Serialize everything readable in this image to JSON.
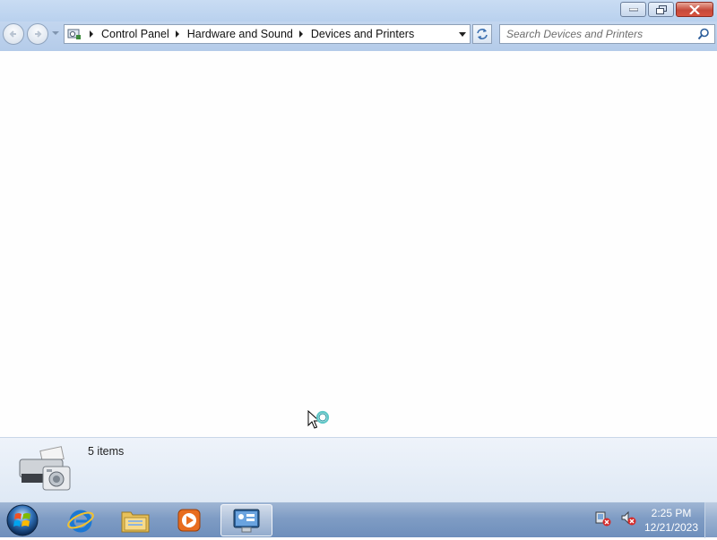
{
  "window": {
    "controls": {
      "minimize": "minimize-icon",
      "maximize": "restore-icon",
      "close": "close-icon"
    }
  },
  "navigation": {
    "back": "back-icon",
    "forward": "forward-icon",
    "recent": "chevron-down-icon"
  },
  "address": {
    "icon": "control-panel-icon",
    "breadcrumbs": [
      "Control Panel",
      "Hardware and Sound",
      "Devices and Printers"
    ]
  },
  "search": {
    "placeholder": "Search Devices and Printers",
    "value": ""
  },
  "details": {
    "icon": "devices-printers-icon",
    "item_count": "5 items"
  },
  "taskbar": {
    "start": "windows-start-icon",
    "pinned": [
      "internet-explorer-icon",
      "file-explorer-icon",
      "media-player-icon",
      "devices-printers-icon"
    ],
    "active": "devices-printers-icon",
    "tray": [
      "network-disconnected-icon",
      "volume-muted-icon"
    ],
    "clock": {
      "time": "2:25 PM",
      "date": "12/21/2023"
    }
  },
  "colors": {
    "titlebar": "#c3d6ef",
    "taskbar": "#7f9cc4",
    "details_pane": "#e6eef8",
    "content_bg": "#fefefe"
  }
}
